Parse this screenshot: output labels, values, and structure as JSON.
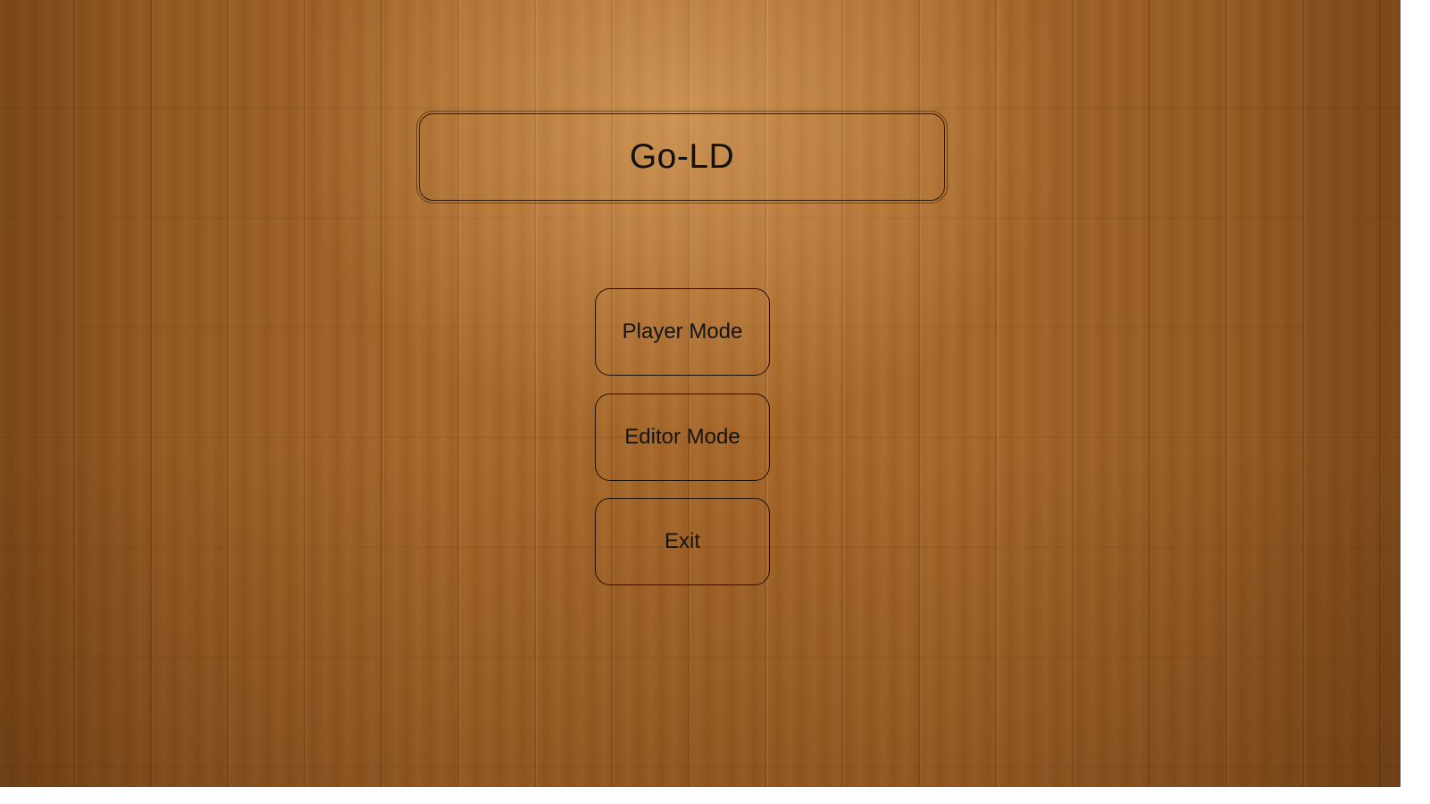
{
  "app": {
    "title": "Go-LD"
  },
  "menu": {
    "items": [
      {
        "label": "Player Mode"
      },
      {
        "label": "Editor Mode"
      },
      {
        "label": "Exit"
      }
    ]
  },
  "colors": {
    "background_wood": "#a76729",
    "border": "#1c1000",
    "text": "#141414"
  }
}
